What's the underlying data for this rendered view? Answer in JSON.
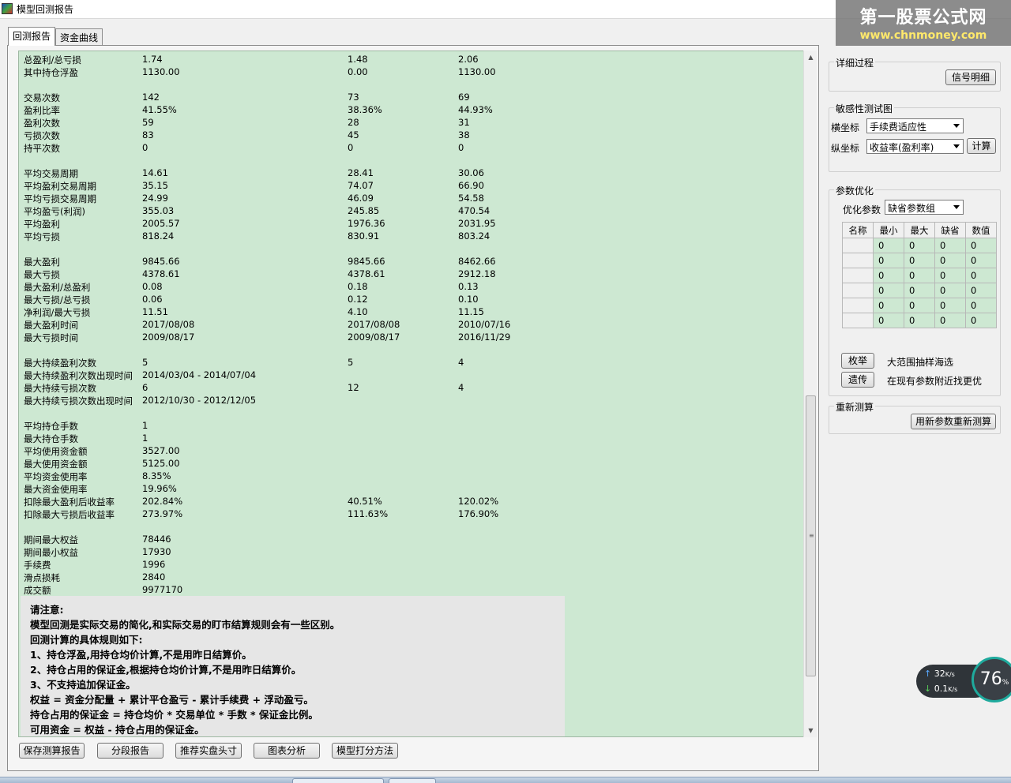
{
  "window": {
    "title": "模型回测报告"
  },
  "watermark": {
    "line1": "第一股票公式网",
    "line2": "www.chnmoney.com"
  },
  "tabs": [
    {
      "label": "回测报告"
    },
    {
      "label": "资金曲线"
    }
  ],
  "report_rows": [
    [
      "总盈利/总亏损",
      "1.74",
      "1.48",
      "2.06"
    ],
    [
      "其中持仓浮盈",
      "1130.00",
      "0.00",
      "1130.00"
    ],
    [
      "",
      "",
      "",
      ""
    ],
    [
      "交易次数",
      "142",
      "73",
      "69"
    ],
    [
      "盈利比率",
      "41.55%",
      "38.36%",
      "44.93%"
    ],
    [
      "盈利次数",
      "59",
      "28",
      "31"
    ],
    [
      "亏损次数",
      "83",
      "45",
      "38"
    ],
    [
      "持平次数",
      "0",
      "0",
      "0"
    ],
    [
      "",
      "",
      "",
      ""
    ],
    [
      "平均交易周期",
      "14.61",
      "28.41",
      "30.06"
    ],
    [
      "平均盈利交易周期",
      "35.15",
      "74.07",
      "66.90"
    ],
    [
      "平均亏损交易周期",
      "24.99",
      "46.09",
      "54.58"
    ],
    [
      "平均盈亏(利润)",
      "355.03",
      "245.85",
      "470.54"
    ],
    [
      "平均盈利",
      "2005.57",
      "1976.36",
      "2031.95"
    ],
    [
      "平均亏损",
      "818.24",
      "830.91",
      "803.24"
    ],
    [
      "",
      "",
      "",
      ""
    ],
    [
      "最大盈利",
      "9845.66",
      "9845.66",
      "8462.66"
    ],
    [
      "最大亏损",
      "4378.61",
      "4378.61",
      "2912.18"
    ],
    [
      "最大盈利/总盈利",
      "0.08",
      "0.18",
      "0.13"
    ],
    [
      "最大亏损/总亏损",
      "0.06",
      "0.12",
      "0.10"
    ],
    [
      "净利润/最大亏损",
      "11.51",
      "4.10",
      "11.15"
    ],
    [
      "最大盈利时间",
      "2017/08/08",
      "2017/08/08",
      "2010/07/16"
    ],
    [
      "最大亏损时间",
      "2009/08/17",
      "2009/08/17",
      "2016/11/29"
    ],
    [
      "",
      "",
      "",
      ""
    ],
    [
      "最大持续盈利次数",
      "5",
      "5",
      "4"
    ],
    [
      "最大持续盈利次数出现时间",
      "2014/03/04 - 2014/07/04",
      "",
      ""
    ],
    [
      "最大持续亏损次数",
      "6",
      "12",
      "4"
    ],
    [
      "最大持续亏损次数出现时间",
      "2012/10/30 - 2012/12/05",
      "",
      ""
    ],
    [
      "",
      "",
      "",
      ""
    ],
    [
      "平均持仓手数",
      "1",
      "",
      ""
    ],
    [
      "最大持仓手数",
      "1",
      "",
      ""
    ],
    [
      "平均使用资金额",
      "3527.00",
      "",
      ""
    ],
    [
      "最大使用资金额",
      "5125.00",
      "",
      ""
    ],
    [
      "平均资金使用率",
      "8.35%",
      "",
      ""
    ],
    [
      "最大资金使用率",
      "19.96%",
      "",
      ""
    ],
    [
      "扣除最大盈利后收益率",
      "202.84%",
      "40.51%",
      "120.02%"
    ],
    [
      "扣除最大亏损后收益率",
      "273.97%",
      "111.63%",
      "176.90%"
    ],
    [
      "",
      "",
      "",
      ""
    ],
    [
      "期间最大权益",
      "78446",
      "",
      ""
    ],
    [
      "期间最小权益",
      "17930",
      "",
      ""
    ],
    [
      "手续费",
      "1996",
      "",
      ""
    ],
    [
      "滑点损耗",
      "2840",
      "",
      ""
    ],
    [
      "成交额",
      "9977170",
      "",
      ""
    ]
  ],
  "notice": [
    "请注意:",
    "模型回测是实际交易的简化,和实际交易的盯市结算规则会有一些区别。",
    "回测计算的具体规则如下:",
    "1、持仓浮盈,用持仓均价计算,不是用昨日结算价。",
    "2、持仓占用的保证金,根据持仓均价计算,不是用昨日结算价。",
    "3、不支持追加保证金。",
    "权益 = 资金分配量 + 累计平仓盈亏 - 累计手续费 + 浮动盈亏。",
    "持仓占用的保证金 = 持仓均价 * 交易单位 * 手数 * 保证金比例。",
    "可用资金 = 权益 - 持仓占用的保证金。"
  ],
  "bottom_buttons": {
    "save": "保存测算报告",
    "segment": "分段报告",
    "recommend": "推荐实盘头寸",
    "chart": "图表分析",
    "score": "模型打分方法"
  },
  "detail": {
    "title": "详细过程",
    "signal_button": "信号明细"
  },
  "sensitivity": {
    "title": "敏感性测试图",
    "x_label": "横坐标",
    "x_value": "手续费适应性",
    "y_label": "纵坐标",
    "y_value": "收益率(盈利率)",
    "calc_button": "计算"
  },
  "optimize": {
    "title": "参数优化",
    "param_label": "优化参数",
    "param_value": "缺省参数组",
    "grid_headers": [
      "名称",
      "最小",
      "最大",
      "缺省",
      "数值"
    ],
    "grid_rows": [
      [
        "",
        "0",
        "0",
        "0",
        "0"
      ],
      [
        "",
        "0",
        "0",
        "0",
        "0"
      ],
      [
        "",
        "0",
        "0",
        "0",
        "0"
      ],
      [
        "",
        "0",
        "0",
        "0",
        "0"
      ],
      [
        "",
        "0",
        "0",
        "0",
        "0"
      ],
      [
        "",
        "0",
        "0",
        "0",
        "0"
      ]
    ],
    "enum_button": "枚举",
    "enum_desc": "大范围抽样海选",
    "genetic_button": "遗传",
    "genetic_desc": "在现有参数附近找更优"
  },
  "recalc": {
    "title": "重新测算",
    "button": "用新参数重新测算"
  },
  "net_monitor": {
    "up": "32",
    "up_unit": "K/s",
    "down": "0.1",
    "down_unit": "K/s",
    "percent": "76",
    "percent_unit": "%"
  }
}
